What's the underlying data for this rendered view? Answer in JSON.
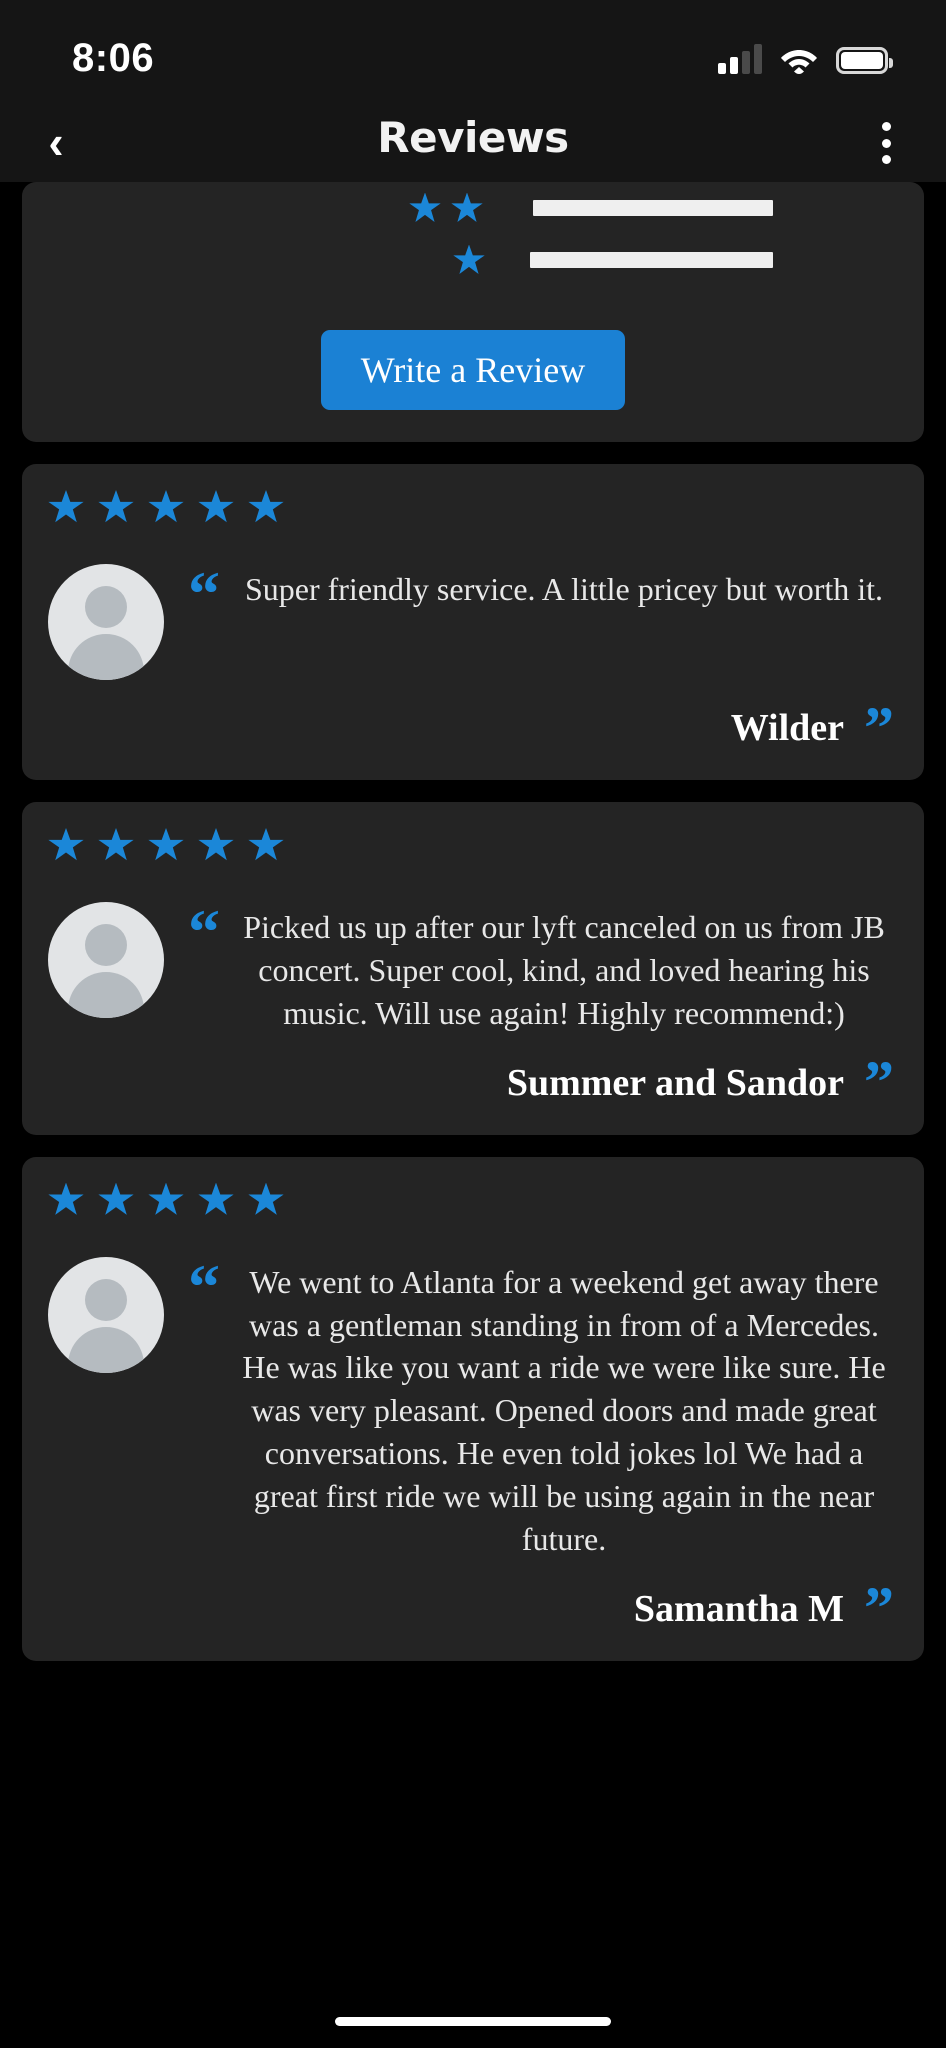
{
  "status_bar": {
    "time": "8:06",
    "cellular_icon": "cellular-signal-icon",
    "wifi_icon": "wifi-icon",
    "battery_icon": "battery-full-icon"
  },
  "nav": {
    "back_icon": "‹",
    "title": "Reviews",
    "menu_icon": "overflow-menu-icon"
  },
  "summary": {
    "rating_rows": [
      {
        "stars": 2,
        "bar_percent": 100
      },
      {
        "stars": 1,
        "bar_percent": 100
      }
    ],
    "write_review_label": "Write a Review"
  },
  "reviews": [
    {
      "stars": 5,
      "quote_open": "“",
      "text": "Super friendly service. A little pricey but worth it.",
      "author": "Wilder",
      "quote_close": "”"
    },
    {
      "stars": 5,
      "quote_open": "“",
      "text": "Picked us up after our lyft canceled on us from JB concert. Super cool, kind, and loved hearing his music. Will use again! Highly recommend:)",
      "author": "Summer and Sandor",
      "quote_close": "”"
    },
    {
      "stars": 5,
      "quote_open": "“",
      "text": "We went to Atlanta for a weekend get away there was a gentleman standing in from of a Mercedes. He was like you want a ride we were like sure. He was very pleasant. Opened doors and made great conversations. He even told jokes lol We had a great first ride we will be using again in the near future.",
      "author": "Samantha M",
      "quote_close": "”"
    }
  ],
  "colors": {
    "background": "#000000",
    "card": "#242424",
    "header": "#151515",
    "accent_blue": "#1b87d8",
    "button_blue": "#1b81d4",
    "text_primary": "#ffffff",
    "bar_fill": "#efefef"
  }
}
